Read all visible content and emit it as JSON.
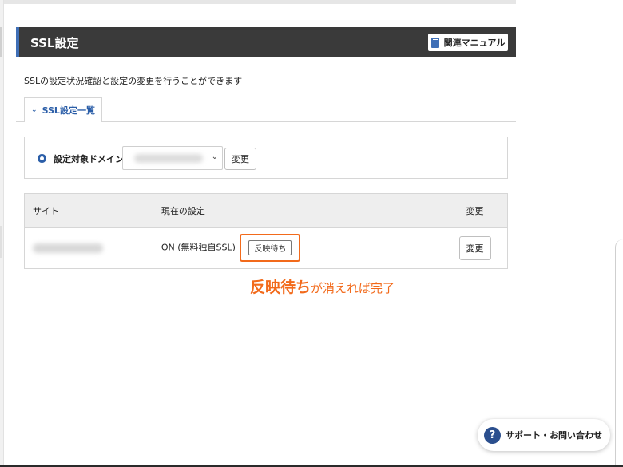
{
  "header": {
    "title": "SSL設定",
    "manual_label": "関連マニュアル"
  },
  "description": "SSLの設定状況確認と設定の変更を行うことができます",
  "tab": {
    "label": "SSL設定一覧",
    "icon": "chevron-down-icon"
  },
  "domain_selector": {
    "label": "設定対象ドメイン",
    "selected_value": "",
    "change_label": "変更"
  },
  "table": {
    "headers": [
      "サイト",
      "現在の設定",
      "変更"
    ],
    "rows": [
      {
        "site": "",
        "current_setting": "ON (無料独自SSL)",
        "status_badge": "反映待ち",
        "change_label": "変更"
      }
    ]
  },
  "annotation": {
    "emphasis": "反映待ち",
    "rest": "が消えれば完了",
    "color": "#f26a1b"
  },
  "support": {
    "label": "サポート・お問い合わせ",
    "icon": "question-icon"
  },
  "colors": {
    "accent": "#3f6fb6",
    "header_bg": "#3a3a3a",
    "highlight": "#f26a1b"
  }
}
